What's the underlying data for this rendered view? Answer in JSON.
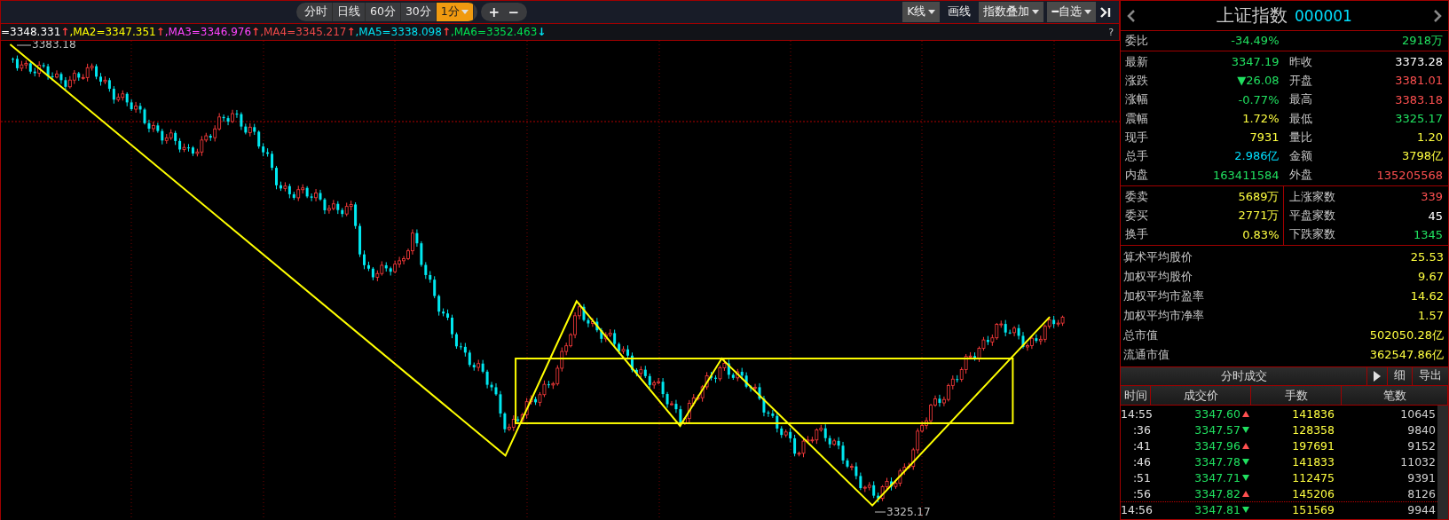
{
  "toolbar": {
    "periods": [
      {
        "label": "分时",
        "selected": false
      },
      {
        "label": "日线",
        "selected": false
      },
      {
        "label": "60分",
        "selected": false
      },
      {
        "label": "30分",
        "selected": false
      },
      {
        "label": "1分",
        "selected": true
      }
    ],
    "zoom_buttons": [
      "+",
      "−"
    ],
    "right_buttons": [
      {
        "label": "K线",
        "kind": "dropdown"
      },
      {
        "label": "画线",
        "kind": "plain"
      },
      {
        "label": "指数叠加",
        "kind": "dropdown"
      },
      {
        "label": "━自选",
        "kind": "dropdown"
      }
    ]
  },
  "ma_legend": [
    {
      "text": "=3348.331",
      "arrow": "↑",
      "rising": true,
      "color": "#ffffff"
    },
    {
      "text": ",MA2=3347.351",
      "arrow": "↑",
      "rising": true,
      "color": "#ffff00"
    },
    {
      "text": ",MA3=3346.976",
      "arrow": "↑",
      "rising": true,
      "color": "#ff44ff"
    },
    {
      "text": ",MA4=3345.217",
      "arrow": "↑",
      "rising": true,
      "color": "#f04848"
    },
    {
      "text": ",MA5=3338.098",
      "arrow": "↑",
      "rising": true,
      "color": "#00e0f0"
    },
    {
      "text": ",MA6=3352.463",
      "arrow": "↓",
      "rising": false,
      "color": "#00e050"
    }
  ],
  "help": "?",
  "chart": {
    "high_label": "3383.18",
    "low_label": "3325.17"
  },
  "quote": {
    "name": "上证指数",
    "code": "000001",
    "ratio": {
      "label": "委比",
      "values": [
        {
          "value": "-34.49%",
          "color": "#20e060"
        },
        {
          "value": "2918万",
          "color": "#20e060"
        }
      ]
    },
    "main": [
      {
        "label": "最新",
        "value": "3347.19",
        "color": "#20e060"
      },
      {
        "label": "昨收",
        "value": "3373.28",
        "color": "#ffffff"
      },
      {
        "label": "涨跌",
        "value": "▼26.08",
        "color": "#20e060"
      },
      {
        "label": "开盘",
        "value": "3381.01",
        "color": "#ff5050"
      },
      {
        "label": "涨幅",
        "value": "-0.77%",
        "color": "#20e060"
      },
      {
        "label": "最高",
        "value": "3383.18",
        "color": "#ff5050"
      },
      {
        "label": "震幅",
        "value": "1.72%",
        "color": "#ffff40"
      },
      {
        "label": "最低",
        "value": "3325.17",
        "color": "#20e060"
      },
      {
        "label": "现手",
        "value": "7931",
        "color": "#ffff40"
      },
      {
        "label": "量比",
        "value": "1.20",
        "color": "#ffff40"
      },
      {
        "label": "总手",
        "value": "2.986亿",
        "color": "#00e0ff"
      },
      {
        "label": "金额",
        "value": "3798亿",
        "color": "#ffff40"
      },
      {
        "label": "内盘",
        "value": "163411584",
        "color": "#20e060"
      },
      {
        "label": "外盘",
        "value": "135205568",
        "color": "#ff5050"
      }
    ],
    "orders": [
      {
        "label": "委卖",
        "value": "5689万",
        "color": "#ffff40"
      },
      {
        "label": "上涨家数",
        "value": "339",
        "color": "#ff5050"
      },
      {
        "label": "委买",
        "value": "2771万",
        "color": "#ffff40"
      },
      {
        "label": "平盘家数",
        "value": "45",
        "color": "#ffffff"
      },
      {
        "label": "换手",
        "value": "0.83%",
        "color": "#ffff40"
      },
      {
        "label": "下跌家数",
        "value": "1345",
        "color": "#20e060"
      }
    ],
    "stats": [
      {
        "label": "算术平均股价",
        "value": "25.53"
      },
      {
        "label": "加权平均股价",
        "value": "9.67"
      },
      {
        "label": "加权平均市盈率",
        "value": "14.62"
      },
      {
        "label": "加权平均市净率",
        "value": "1.57"
      },
      {
        "label": "总市值",
        "value": "502050.28亿"
      },
      {
        "label": "流通市值",
        "value": "362547.86亿"
      }
    ]
  },
  "trades": {
    "title": "分时成交",
    "detail_button": "细",
    "export_button": "导出",
    "columns": [
      "时间",
      "成交价",
      "手数",
      "笔数"
    ],
    "rows": [
      {
        "time": "14:55",
        "price": "3347.60",
        "rising": true,
        "volume": "141836",
        "count": "10645",
        "new_minute": false
      },
      {
        "time": ":36",
        "price": "3347.57",
        "rising": false,
        "volume": "128358",
        "count": "9840",
        "new_minute": false
      },
      {
        "time": ":41",
        "price": "3347.96",
        "rising": true,
        "volume": "197691",
        "count": "9152",
        "new_minute": false
      },
      {
        "time": ":46",
        "price": "3347.78",
        "rising": false,
        "volume": "141833",
        "count": "11032",
        "new_minute": false
      },
      {
        "time": ":51",
        "price": "3347.71",
        "rising": false,
        "volume": "112475",
        "count": "9391",
        "new_minute": false
      },
      {
        "time": ":56",
        "price": "3347.82",
        "rising": true,
        "volume": "145206",
        "count": "8126",
        "new_minute": false
      },
      {
        "time": "14:56",
        "price": "3347.81",
        "rising": false,
        "volume": "151569",
        "count": "9944",
        "new_minute": true
      }
    ]
  }
}
